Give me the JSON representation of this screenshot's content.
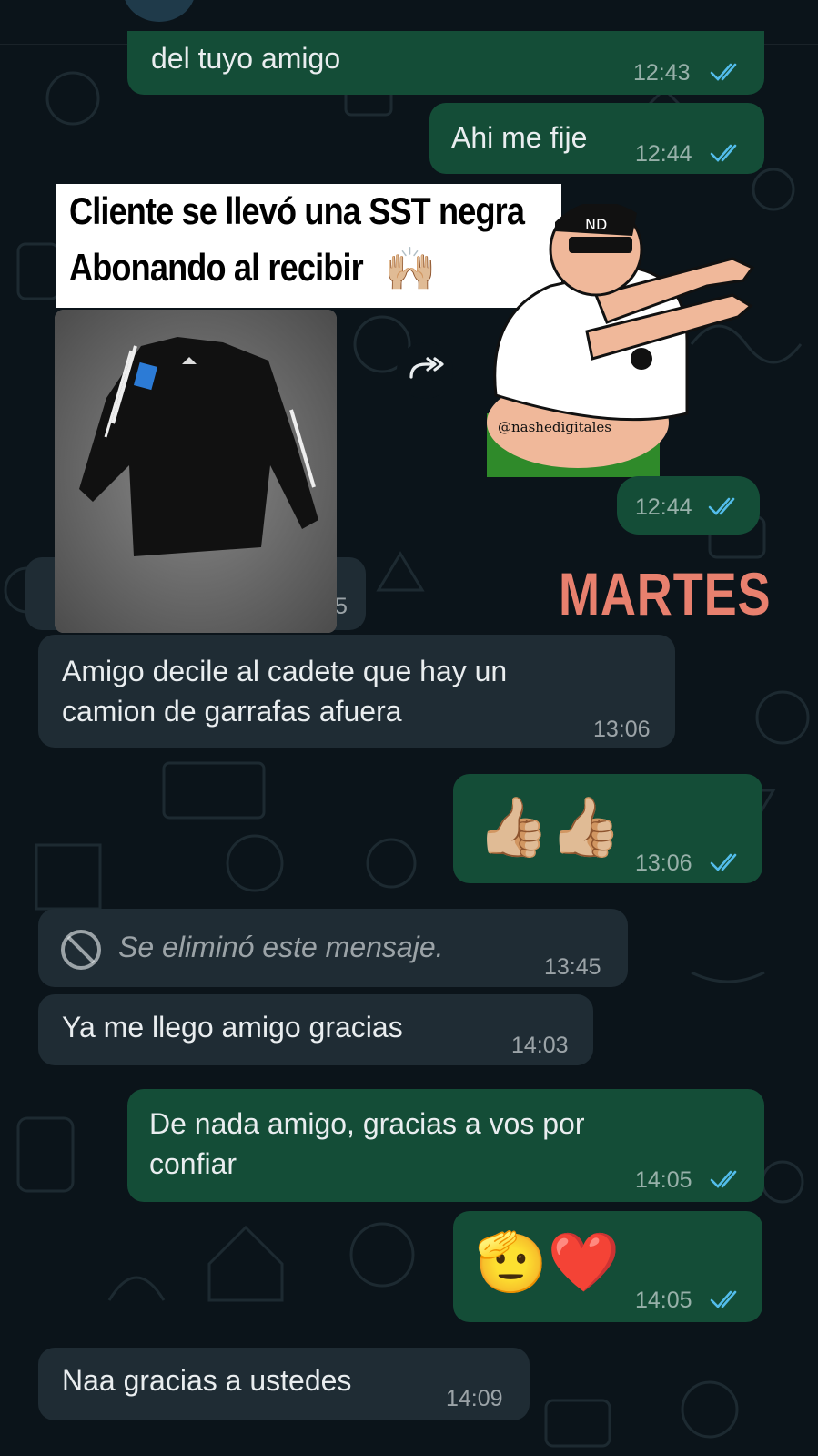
{
  "messages": [
    {
      "text": "del tuyo amigo",
      "time": "12:43"
    },
    {
      "text": "Ahi me fije",
      "time": "12:44"
    },
    {
      "time": "12:44"
    },
    {
      "time_partial": "5"
    },
    {
      "text_lines": [
        "Amigo decile al cadete que hay un",
        "camion de garrafas afuera"
      ],
      "time": "13:06"
    },
    {
      "emoji": "👍🏼👍🏼",
      "time": "13:06"
    },
    {
      "text": "Se eliminó este mensaje.",
      "time": "13:45"
    },
    {
      "text": "Ya me llego amigo gracias",
      "time": "14:03"
    },
    {
      "text_lines": [
        "De nada amigo, gracias a vos por",
        "confiar"
      ],
      "time": "14:05"
    },
    {
      "emoji": "🫡❤️",
      "time": "14:05"
    },
    {
      "text": "Naa gracias a ustedes",
      "time": "14:09"
    }
  ],
  "overlay": {
    "line1": "Cliente se llevó una SST negra",
    "line2": "Abonando al recibir",
    "line2_emoji": "🙌🏼",
    "day_label": "MARTES"
  },
  "sticker": {
    "watermark": "@nashedigitales",
    "cap_logo": "ND"
  },
  "colors": {
    "background": "#0b141a",
    "outgoing_bubble": "#144d37",
    "incoming_bubble": "#1f2c34",
    "read_ticks": "#53bdeb",
    "day_label": "#e8806e"
  },
  "icons": [
    "double-check-icon",
    "forward-icon",
    "deleted-message-icon"
  ]
}
